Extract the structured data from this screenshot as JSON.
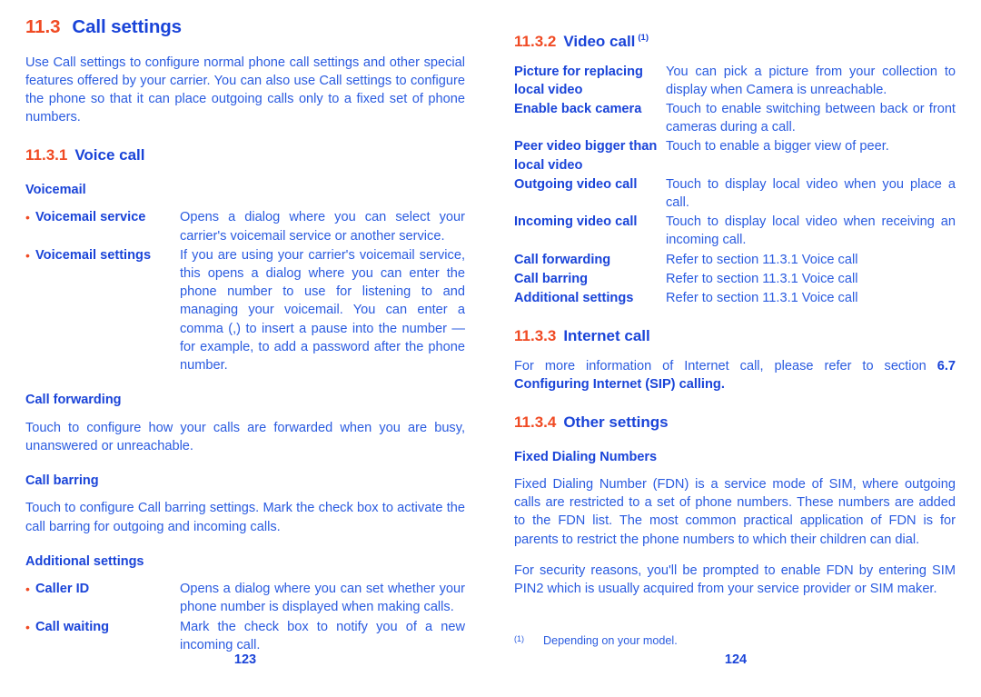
{
  "document": {
    "type": "user-manual-spread"
  },
  "left_page": {
    "page_number": "123",
    "section": {
      "number": "11.3",
      "title": "Call settings"
    },
    "intro_paragraph": "Use Call settings to configure normal phone call settings and other special features offered by your carrier. You can also use Call settings to configure the phone so that it can place outgoing calls only to a fixed set of phone numbers.",
    "subsection_voice_call": {
      "number": "11.3.1",
      "title": "Voice call"
    },
    "voicemail_heading": "Voicemail",
    "voicemail_items": [
      {
        "bullet": "•",
        "term": "Voicemail service",
        "description": "Opens a dialog where you can select your carrier's voicemail service or another service."
      },
      {
        "bullet": "•",
        "term": "Voicemail settings",
        "description": "If you are using your carrier's voicemail service, this opens a dialog where you can enter the phone number to use for listening to and managing your voicemail. You can enter a comma (,) to insert a pause into the number — for example, to add a password after the phone number."
      }
    ],
    "call_forwarding_heading": "Call forwarding",
    "call_forwarding_text": "Touch to configure how your calls are forwarded when you are busy, unanswered or unreachable.",
    "call_barring_heading": "Call barring",
    "call_barring_text": "Touch to configure Call barring settings. Mark the check box to activate the call barring for outgoing and incoming calls.",
    "additional_settings_heading": "Additional settings",
    "additional_settings_items": [
      {
        "bullet": "•",
        "term": "Caller ID",
        "description": "Opens a dialog where you can set whether your phone number is displayed when making calls."
      },
      {
        "bullet": "•",
        "term": "Call waiting",
        "description": "Mark the check box to notify you of a new incoming call."
      }
    ]
  },
  "right_page": {
    "page_number": "124",
    "subsection_video_call": {
      "number": "11.3.2",
      "title": "Video call",
      "footnote_marker": "(1)"
    },
    "video_call_items": [
      {
        "term": "Picture for replacing local video",
        "description": "You can pick a picture from your collection to display when Camera is unreachable."
      },
      {
        "term": "Enable back camera",
        "description": "Touch to enable switching between back or front cameras during a call."
      },
      {
        "term": "Peer video bigger than local video",
        "description": "Touch to enable a bigger view of peer."
      },
      {
        "term": "Outgoing video call",
        "description": "Touch to display local video when you place a call."
      },
      {
        "term": "Incoming video call",
        "description": "Touch to display local video when receiving an incoming call."
      },
      {
        "term": "Call forwarding",
        "description": "Refer to section 11.3.1 Voice call"
      },
      {
        "term": "Call barring",
        "description": "Refer to section 11.3.1 Voice call"
      },
      {
        "term": "Additional settings",
        "description": "Refer to section 11.3.1 Voice call"
      }
    ],
    "subsection_internet_call": {
      "number": "11.3.3",
      "title": "Internet call"
    },
    "internet_call_text_plain": "For more information of Internet call, please refer to section ",
    "internet_call_text_bold": "6.7 Configuring Internet (SIP) calling.",
    "subsection_other_settings": {
      "number": "11.3.4",
      "title": "Other settings"
    },
    "fixed_dialing_heading": "Fixed Dialing Numbers",
    "fixed_dialing_paragraph_1": "Fixed Dialing Number (FDN) is a service mode of SIM, where outgoing calls are restricted to a set of phone numbers. These numbers are added to the FDN list. The most common practical application of FDN is for parents to restrict the phone numbers to which their children can dial.",
    "fixed_dialing_paragraph_2": "For security reasons, you'll be prompted to enable FDN by entering SIM PIN2 which is usually acquired from your service provider or SIM maker.",
    "footnote": {
      "marker": "(1)",
      "text": "Depending on your model."
    }
  },
  "colors": {
    "accent_orange": "#f04a23",
    "heading_blue": "#1a44d8",
    "body_blue": "#2a5be0",
    "background": "#ffffff"
  }
}
